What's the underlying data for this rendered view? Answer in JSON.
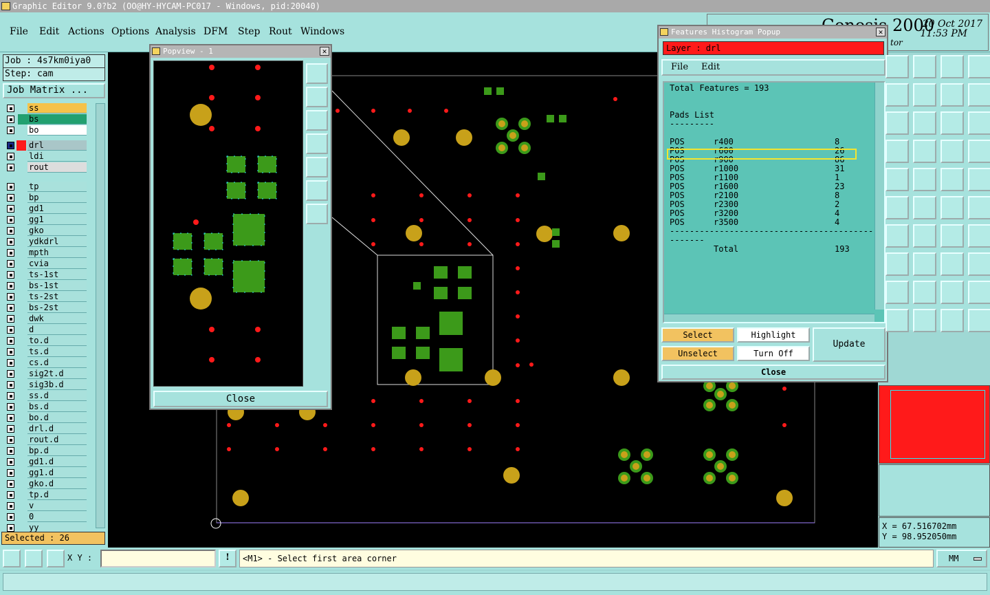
{
  "app": {
    "title": "Graphic Editor 9.0?b2 (OO@HY-HYCAM-PC017 - Windows, pid:20040)"
  },
  "brand": {
    "logo_text": "Genesis 2000",
    "subtitle": "tor",
    "date": "20 Oct 2017",
    "time": "11:53 PM"
  },
  "menu": [
    "File",
    "Edit",
    "Actions",
    "Options",
    "Analysis",
    "DFM",
    "Step",
    "Rout",
    "Windows"
  ],
  "job": {
    "job_label": "Job : 4s7km0iya0",
    "step_label": "Step: cam",
    "matrix_button": "Job Matrix ..."
  },
  "layers": [
    "ss",
    "bs",
    "bo",
    "drl",
    "ldi",
    "rout",
    "tp",
    "bp",
    "gd1",
    "gg1",
    "gko",
    "ydkdrl",
    "mpth",
    "cvia",
    "ts-1st",
    "bs-1st",
    "ts-2st",
    "bs-2st",
    "dwk",
    "d",
    "to.d",
    "ts.d",
    "cs.d",
    "sig2t.d",
    "sig3b.d",
    "ss.d",
    "bs.d",
    "bo.d",
    "drl.d",
    "rout.d",
    "bp.d",
    "gd1.d",
    "gg1.d",
    "gko.d",
    "tp.d",
    "v",
    "0",
    "yy"
  ],
  "layer_colors": {
    "ss": "#f5c24a",
    "bs": "#22a070",
    "bo": "#ffffff",
    "drl": "#a9c6c8",
    "ldi": "#a9e1dc",
    "rout": "#dddddd"
  },
  "selected_status": "Selected : 26",
  "popview": {
    "title": "Popview - 1",
    "close_label": "Close"
  },
  "histogram": {
    "title": "Features Histogram Popup",
    "layer_label": "Layer :  drl",
    "menu": [
      "File",
      "Edit"
    ],
    "total_line": "Total Features = 193",
    "pads_title": "Pads List",
    "dash_short": "---------",
    "rows": [
      {
        "pol": "POS",
        "sym": "r400",
        "count": "8"
      },
      {
        "pol": "POS",
        "sym": "r600",
        "count": "26"
      },
      {
        "pol": "POS",
        "sym": "r900",
        "count": "86"
      },
      {
        "pol": "POS",
        "sym": "r1000",
        "count": "31"
      },
      {
        "pol": "POS",
        "sym": "r1100",
        "count": "1"
      },
      {
        "pol": "POS",
        "sym": "r1600",
        "count": "23"
      },
      {
        "pol": "POS",
        "sym": "r2100",
        "count": "8"
      },
      {
        "pol": "POS",
        "sym": "r2300",
        "count": "2"
      },
      {
        "pol": "POS",
        "sym": "r3200",
        "count": "4"
      },
      {
        "pol": "POS",
        "sym": "r3500",
        "count": "4"
      }
    ],
    "dash_long": "--------------------------------------------------",
    "total_label": "Total",
    "total_value": "193",
    "buttons": {
      "select": "Select",
      "highlight": "Highlight",
      "update": "Update",
      "unselect": "Unselect",
      "turn_off": "Turn Off",
      "close": "Close"
    }
  },
  "coords": {
    "x": "X = 67.516702mm",
    "y": "Y = 98.952050mm"
  },
  "status": {
    "xy_label": "X Y :",
    "prompt": "<M1> - Select first area corner",
    "units": "MM"
  },
  "colors": {
    "pad_green": "#3c9a1a",
    "pad_gold": "#c8a11a",
    "drill_red": "#ff1a1a",
    "cyan": "#2ee6f0",
    "highlight": "#f5e52e",
    "layer_red": "#ff1a1a"
  }
}
